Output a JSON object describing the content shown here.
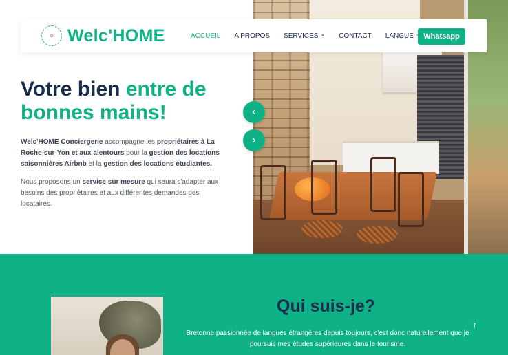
{
  "nav": {
    "logo_text": "Welc'HOME",
    "items": [
      {
        "label": "ACCUEIL",
        "active": true,
        "has_caret": false
      },
      {
        "label": "A PROPOS",
        "active": false,
        "has_caret": false
      },
      {
        "label": "SERVICES",
        "active": false,
        "has_caret": true
      },
      {
        "label": "CONTACT",
        "active": false,
        "has_caret": false
      },
      {
        "label": "LANGUE",
        "active": false,
        "has_caret": true
      }
    ],
    "whatsapp_label": "Whatsapp"
  },
  "hero": {
    "title_part1": "Votre bien ",
    "title_accent": "entre de bonnes mains!",
    "p1": [
      {
        "text": "Welc'HOME Conciergerie",
        "bold": true
      },
      {
        "text": " accompagne les ",
        "bold": false
      },
      {
        "text": "propriétaires à La Roche-sur-Yon et aux alentours",
        "bold": true
      },
      {
        "text": " pour la ",
        "bold": false
      },
      {
        "text": "gestion des locations saisonnières Airbnb",
        "bold": true
      },
      {
        "text": " et la ",
        "bold": false
      },
      {
        "text": "gestion des locations étudiantes.",
        "bold": true
      }
    ],
    "p2": [
      {
        "text": "Nous proposons un ",
        "bold": false
      },
      {
        "text": "service sur mesure",
        "bold": true
      },
      {
        "text": " qui saura s'adapter aux besoins des propriétaires et aux différentes demandes des locataires.",
        "bold": false
      }
    ],
    "prev_icon": "chevron-left-icon",
    "next_icon": "chevron-right-icon"
  },
  "about": {
    "title": "Qui suis-je?",
    "text": "Bretonne passionnée de langues étrangères depuis toujours, c'est donc naturellement que je poursuis mes études supérieures dans le tourisme."
  },
  "colors": {
    "brand": "#0fb286",
    "navy": "#1a2d4d"
  }
}
